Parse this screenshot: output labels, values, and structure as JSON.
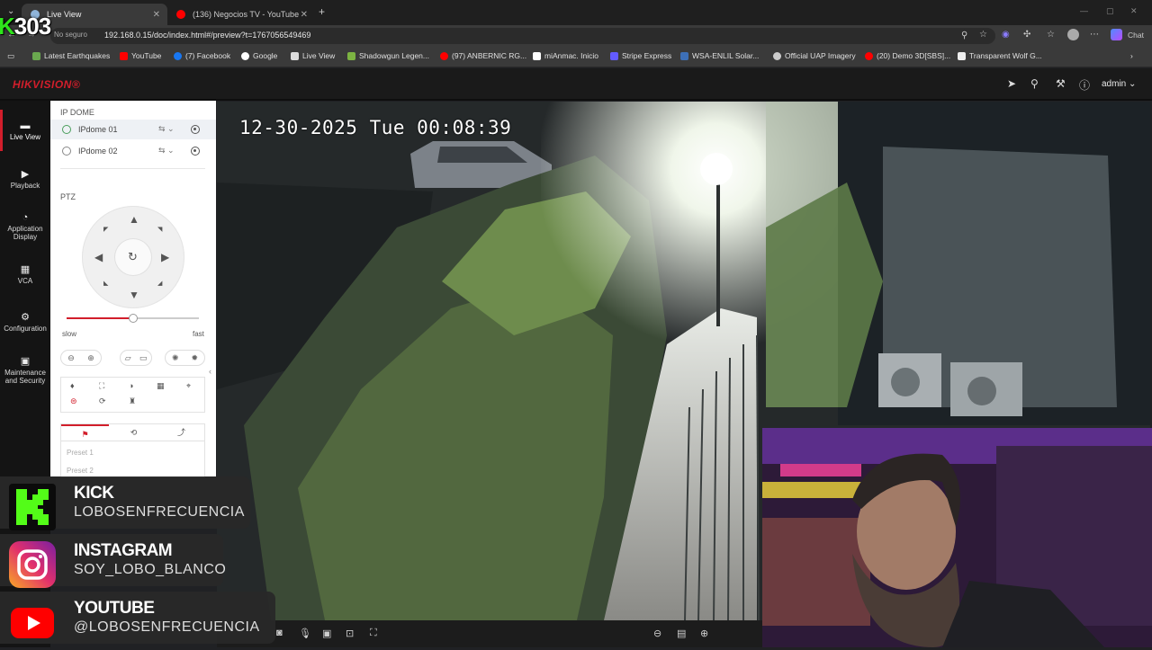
{
  "browser": {
    "tabs": [
      {
        "title": "Live View",
        "active": true
      },
      {
        "title": "(136) Negocios TV - YouTube",
        "active": false
      }
    ],
    "new_tab": "+",
    "url_security": "No seguro",
    "url": "192.168.0.15/doc/index.html#/preview?t=1767056549469",
    "chat_label": "Chat",
    "bookmarks": [
      "Latest Earthquakes",
      "YouTube",
      "(7) Facebook",
      "Google",
      "Live View",
      "Shadowgun Legen...",
      "(97) ANBERNIC RG...",
      "miAnmac. Inicio",
      "Stripe Express",
      "WSA-ENLIL Solar...",
      "Official UAP Imagery",
      "(20) Demo 3D[SBS]...",
      "Transparent Wolf G..."
    ]
  },
  "hik": {
    "logo": "HIKVISION®",
    "user": "admin",
    "nav": [
      {
        "label": "Live View",
        "icon": "monitor-icon"
      },
      {
        "label": "Playback",
        "icon": "playback-icon"
      },
      {
        "label": "Application Display",
        "icon": "application-icon"
      },
      {
        "label": "VCA",
        "icon": "vca-icon"
      },
      {
        "label": "Configuration",
        "icon": "gear-icon"
      },
      {
        "label": "Maintenance and Security",
        "icon": "maintenance-icon"
      }
    ],
    "panel_title": "IP DOME",
    "cameras": [
      "IPdome 01",
      "IPdome 02"
    ],
    "ptz_label": "PTZ",
    "speed": {
      "slow": "slow",
      "fast": "fast",
      "value": 0.5
    },
    "presets": [
      "Preset 1",
      "Preset 2"
    ]
  },
  "video": {
    "osd": "12-30-2025 Tue 00:08:39"
  },
  "overlay": {
    "counter": "303",
    "counter_prefix": "K",
    "socials": [
      {
        "name": "KICK",
        "handle": "LOBOSENFRECUENCIA",
        "color": "#53fc18"
      },
      {
        "name": "INSTAGRAM",
        "handle": "SOY_LOBO_BLANCO",
        "color": "#e1306c"
      },
      {
        "name": "YOUTUBE",
        "handle": "@LOBOSENFRECUENCIA",
        "color": "#ff0000"
      }
    ]
  },
  "colors": {
    "hik_red": "#d21e2b",
    "kick_green": "#53fc18"
  }
}
